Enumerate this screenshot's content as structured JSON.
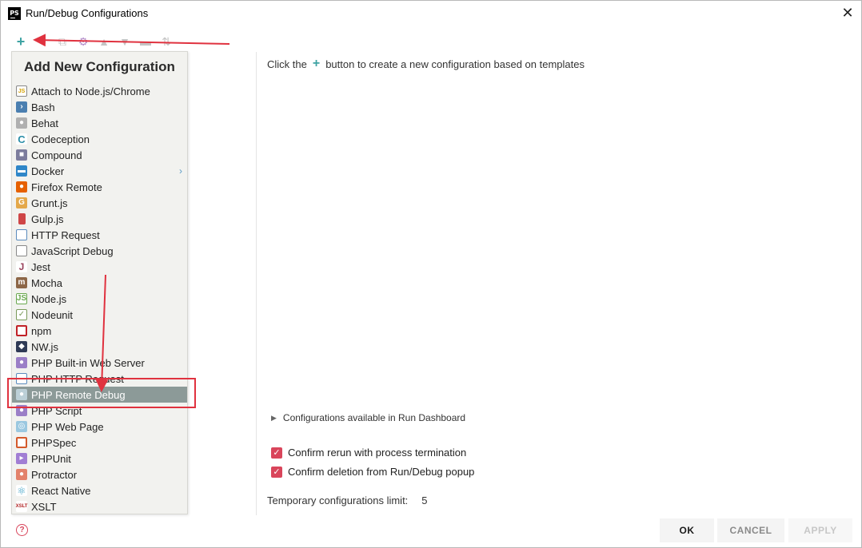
{
  "window": {
    "title": "Run/Debug Configurations",
    "app_icon_text": "PS"
  },
  "toolbar": {
    "add_icon": "plus-icon",
    "buttons": [
      "remove",
      "copy",
      "edit-templates",
      "move-up",
      "move-down",
      "folder",
      "sort"
    ]
  },
  "popup": {
    "title": "Add New Configuration",
    "items": [
      {
        "label": "Attach to Node.js/Chrome",
        "icon": "attach-nodejs-icon"
      },
      {
        "label": "Bash",
        "icon": "bash-icon"
      },
      {
        "label": "Behat",
        "icon": "behat-icon"
      },
      {
        "label": "Codeception",
        "icon": "codeception-icon"
      },
      {
        "label": "Compound",
        "icon": "compound-icon"
      },
      {
        "label": "Docker",
        "icon": "docker-icon",
        "has_submenu": true
      },
      {
        "label": "Firefox Remote",
        "icon": "firefox-icon"
      },
      {
        "label": "Grunt.js",
        "icon": "grunt-icon"
      },
      {
        "label": "Gulp.js",
        "icon": "gulp-icon"
      },
      {
        "label": "HTTP Request",
        "icon": "http-request-icon"
      },
      {
        "label": "JavaScript Debug",
        "icon": "javascript-debug-icon"
      },
      {
        "label": "Jest",
        "icon": "jest-icon"
      },
      {
        "label": "Mocha",
        "icon": "mocha-icon"
      },
      {
        "label": "Node.js",
        "icon": "nodejs-icon"
      },
      {
        "label": "Nodeunit",
        "icon": "nodeunit-icon"
      },
      {
        "label": "npm",
        "icon": "npm-icon"
      },
      {
        "label": "NW.js",
        "icon": "nwjs-icon"
      },
      {
        "label": "PHP Built-in Web Server",
        "icon": "php-builtin-server-icon"
      },
      {
        "label": "PHP HTTP Request",
        "icon": "php-http-request-icon"
      },
      {
        "label": "PHP Remote Debug",
        "icon": "php-remote-debug-icon",
        "selected": true
      },
      {
        "label": "PHP Script",
        "icon": "php-script-icon"
      },
      {
        "label": "PHP Web Page",
        "icon": "php-web-page-icon"
      },
      {
        "label": "PHPSpec",
        "icon": "phpspec-icon"
      },
      {
        "label": "PHPUnit",
        "icon": "phpunit-icon"
      },
      {
        "label": "Protractor",
        "icon": "protractor-icon"
      },
      {
        "label": "React Native",
        "icon": "react-native-icon"
      },
      {
        "label": "XSLT",
        "icon": "xslt-icon"
      }
    ]
  },
  "main": {
    "hint_before": "Click the",
    "hint_after": "button to create a new configuration based on templates",
    "dashboard_label": "Configurations available in Run Dashboard",
    "confirm_rerun": {
      "label": "Confirm rerun with process termination",
      "checked": true
    },
    "confirm_deletion": {
      "label": "Confirm deletion from Run/Debug popup",
      "checked": true
    },
    "temp_limit_label": "Temporary configurations limit:",
    "temp_limit_value": "5"
  },
  "buttons": {
    "ok": "OK",
    "cancel": "CANCEL",
    "apply": "APPLY"
  },
  "colors": {
    "accent_teal": "#3ea3a3",
    "checkbox_red": "#d9455b",
    "selection_gray": "#8c9a98",
    "annotation_red": "#e0323f"
  }
}
